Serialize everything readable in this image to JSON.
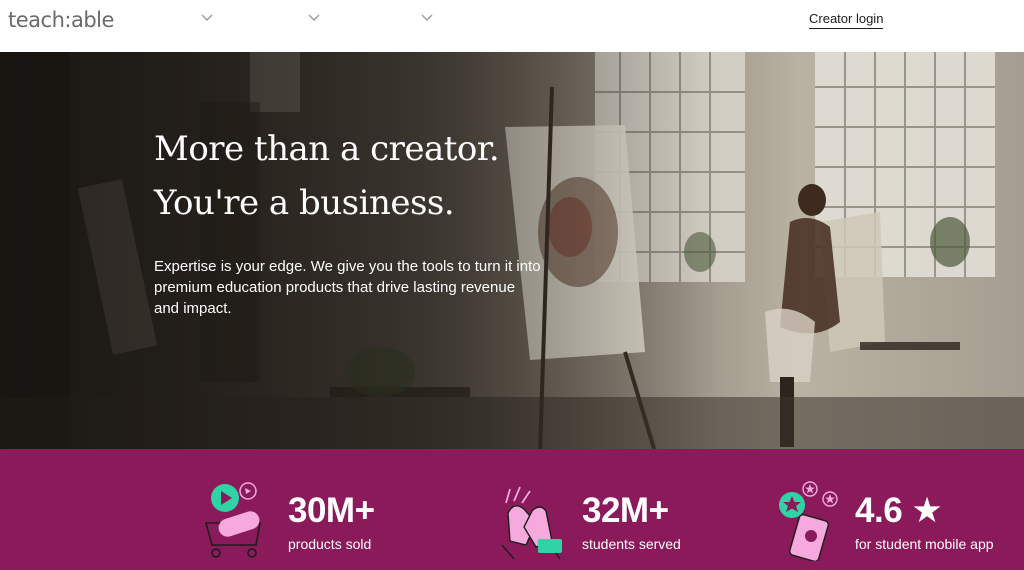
{
  "header": {
    "logo": "teach:able",
    "nav_chevrons": [
      "chevron-down-icon",
      "chevron-down-icon",
      "chevron-down-icon"
    ],
    "login_label": "Creator login"
  },
  "hero": {
    "headline_line1": "More than a creator.",
    "headline_line2": "You're a business.",
    "subtext": "Expertise is your edge. We give you the tools to turn it into premium education products that drive lasting revenue and impact."
  },
  "stats": [
    {
      "value": "30M+",
      "label": "products sold",
      "icon": "shopping-cart-icon"
    },
    {
      "value": "32M+",
      "label": "students served",
      "icon": "high-five-icon"
    },
    {
      "value": "4.6 ★",
      "label": "for student mobile app",
      "icon": "mobile-app-rating-icon"
    }
  ],
  "colors": {
    "band": "#8b1a5a",
    "accent_green": "#2fd3a6",
    "accent_pink": "#f5a9dc"
  }
}
